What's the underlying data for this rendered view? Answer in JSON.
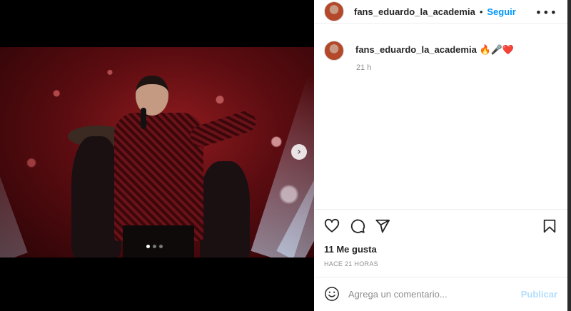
{
  "post": {
    "username": "fans_eduardo_la_academia",
    "separator": "•",
    "follow_label": "Seguir",
    "more_icon": "more-horizontal-icon",
    "caption_emojis": "🔥🎤❤️",
    "caption_time": "21 h",
    "likes_text": "11 Me gusta",
    "date_text": "HACE 21 HORAS",
    "carousel": {
      "total": 3,
      "active": 1
    },
    "next_icon": "chevron-right-icon"
  },
  "actions": {
    "like_icon": "heart-icon",
    "comment_icon": "comment-icon",
    "share_icon": "paper-plane-icon",
    "save_icon": "bookmark-icon"
  },
  "comment_box": {
    "emoji_icon": "emoji-smile-icon",
    "placeholder": "Agrega un comentario...",
    "publish_label": "Publicar"
  },
  "colors": {
    "accent": "#0095f6",
    "publish_disabled": "#b2dffc",
    "text": "#262626",
    "muted": "#8e8e8e"
  }
}
